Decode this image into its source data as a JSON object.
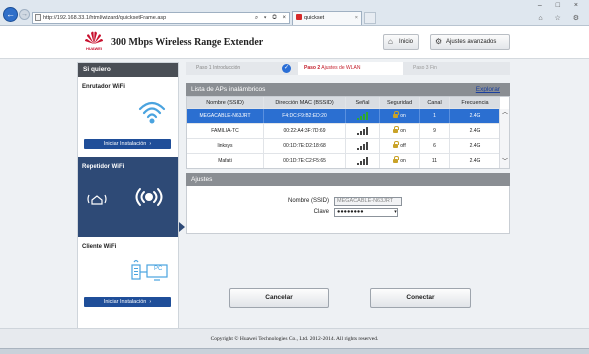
{
  "browser": {
    "url": "http://192.168.33.1/html/wizard/quicksetFrame.asp",
    "tab_title": "quickset",
    "tab_close": "×",
    "window_controls": "– □ ×",
    "tool_icons": "⌂ ☆ ⚙",
    "addr_tools": "⌕ ▾ ◎ ×"
  },
  "header": {
    "brand": "HUAWEI",
    "product_title": "300 Mbps Wireless Range Extender",
    "home_label": "Inicio",
    "advanced_label": "Ajustes avanzados"
  },
  "sidebar": {
    "title": "Si quiero",
    "sections": [
      {
        "title": "Enrutador WiFi",
        "button": "Iniciar Instalación"
      },
      {
        "title": "Repetidor WiFi"
      },
      {
        "title": "Cliente WiFi",
        "button": "Iniciar Instalación",
        "device_label": "PC"
      }
    ]
  },
  "steps": [
    {
      "num": "Paso 1",
      "label": "Introducción",
      "state": "done"
    },
    {
      "num": "Paso 2",
      "label": "Ajustes de WLAN",
      "state": "current"
    },
    {
      "num": "Paso 3",
      "label": "Fin",
      "state": "pending"
    }
  ],
  "ap_list": {
    "title": "Lista de APs inalámbricos",
    "explore_label": "Explorar",
    "columns": [
      "Nombre (SSID)",
      "Dirección MAC (BSSID)",
      "Señal",
      "Seguridad",
      "Canal",
      "Frecuencia"
    ],
    "rows": [
      {
        "ssid": "MEGACABLE-N63JRT",
        "mac": "F4:DC:F9:B2:ED:20",
        "signal": 4,
        "security": "on",
        "channel": "1",
        "frequency": "2.4G",
        "selected": true
      },
      {
        "ssid": "FAMILIA-TC",
        "mac": "00:22:A4:3F:7D:69",
        "signal": 4,
        "security": "on",
        "channel": "9",
        "frequency": "2.4G",
        "selected": false
      },
      {
        "ssid": "linksys",
        "mac": "00:1D:7E:D2:18:68",
        "signal": 4,
        "security": "off",
        "channel": "6",
        "frequency": "2.4G",
        "selected": false
      },
      {
        "ssid": "Mafati",
        "mac": "00:1D:7E:C2:F5:65",
        "signal": 4,
        "security": "on",
        "channel": "11",
        "frequency": "2.4G",
        "selected": false
      }
    ]
  },
  "settings": {
    "title": "Ajustes",
    "ssid_label": "Nombre (SSID)",
    "ssid_value": "MEGACABLE-N63JRT",
    "password_label": "Clave",
    "password_value": "●●●●●●●●"
  },
  "actions": {
    "cancel_label": "Cancelar",
    "connect_label": "Conectar"
  },
  "footer": {
    "copyright": "Copyright © Huawei Technologies Co., Ltd. 2012-2014. All rights reserved."
  },
  "colors": {
    "brand_red": "#c8102e",
    "selected_row": "#2b6fd1",
    "signal_green": "#2fa82f",
    "signal_dark": "#444444",
    "active_sidebar": "#2e4a76"
  }
}
